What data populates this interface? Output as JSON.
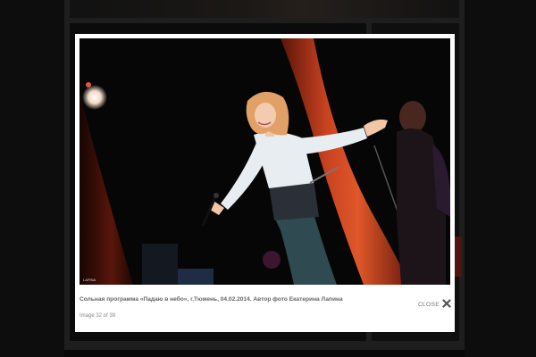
{
  "lightbox": {
    "caption": "Сольная программа «Падаю в небо», г.Тюмень, 04.02.2014. Автор фото Екатерина Лапина",
    "counter": "Image 32 of 38",
    "close_label": "CLOSE",
    "photo_watermark": "LAPINA"
  },
  "icons": {
    "close": "close-icon"
  },
  "colors": {
    "page_background": "#0d0d0d",
    "frame": "#2f2f2f",
    "lightbox_background": "#ffffff",
    "stage_curtain": "#c0391f"
  }
}
